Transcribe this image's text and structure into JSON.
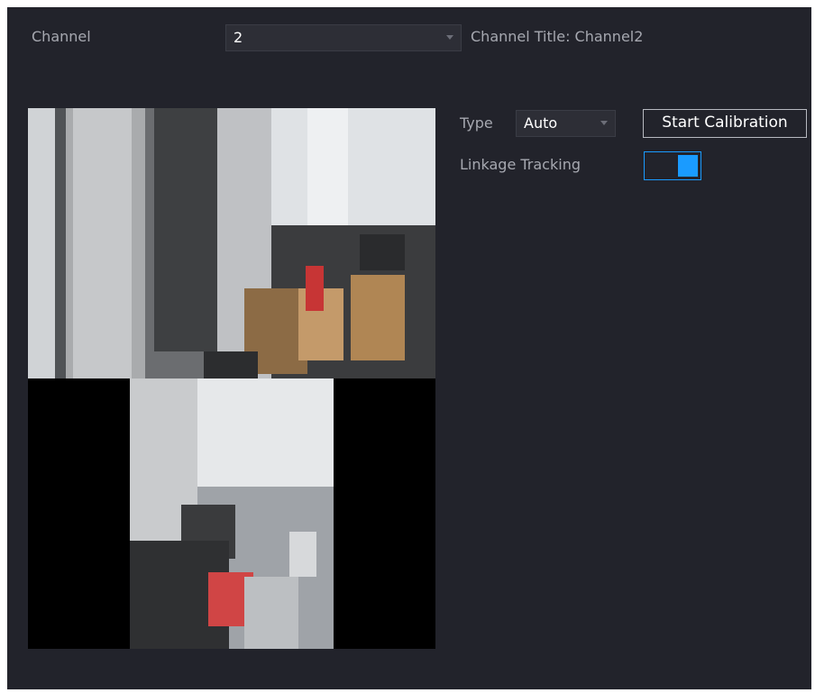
{
  "channel": {
    "label": "Channel",
    "selected": "2",
    "title_text": "Channel Title: Channel2"
  },
  "type": {
    "label": "Type",
    "selected": "Auto"
  },
  "calibration": {
    "button_label": "Start Calibration"
  },
  "linkage": {
    "label": "Linkage Tracking",
    "enabled": true
  },
  "colors": {
    "background": "#22232b",
    "accent": "#1a9bff"
  }
}
